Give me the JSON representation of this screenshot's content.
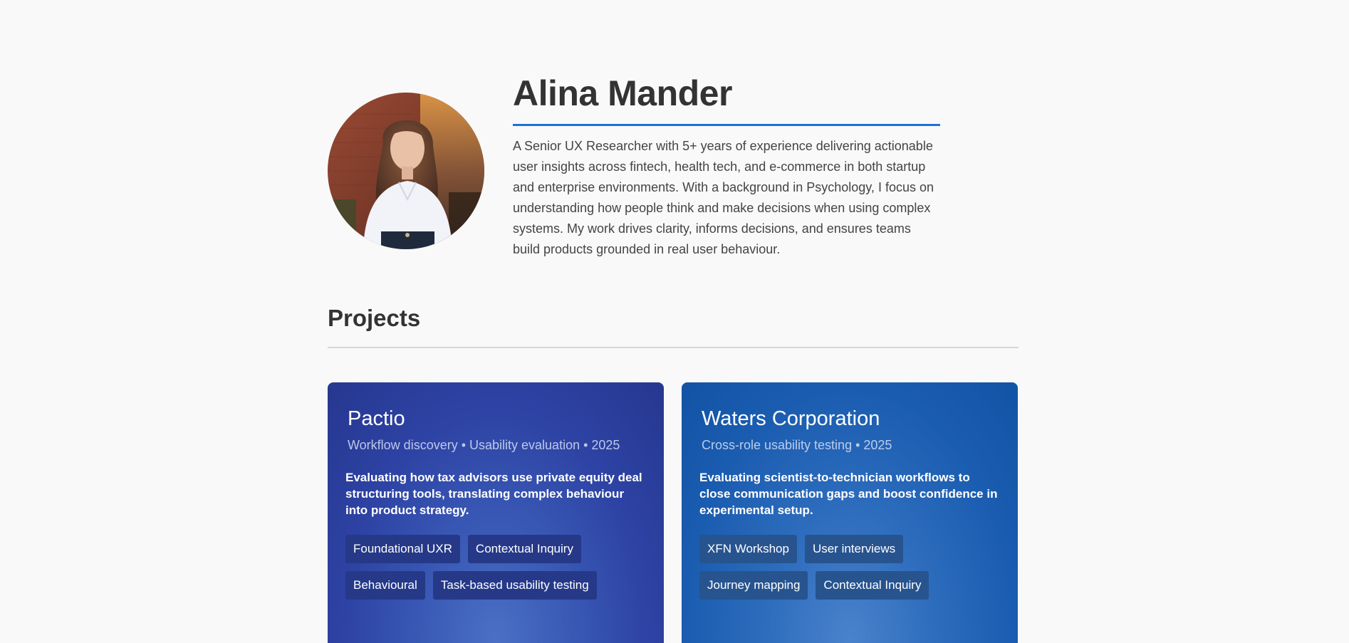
{
  "profile": {
    "name": "Alina Mander",
    "bio": "A Senior UX Researcher with 5+ years of experience delivering actionable user insights across fintech, health tech, and e-commerce in both startup and enterprise environments. With a background in Psychology, I focus on understanding how people think and make decisions when using complex systems. My work drives clarity, informs decisions, and ensures teams build products grounded in real user behaviour.",
    "accent_color": "#1a73d9"
  },
  "projects": {
    "heading": "Projects",
    "cards": [
      {
        "title": "Pactio",
        "meta": "Workflow discovery • Usability evaluation • 2025",
        "description": "Evaluating how tax advisors use private equity deal structuring tools, translating complex behaviour into product strategy.",
        "tags": [
          "Foundational UXR",
          "Contextual Inquiry",
          "Behavioural",
          "Task-based usability testing"
        ],
        "color": "#2d42a3"
      },
      {
        "title": "Waters Corporation",
        "meta": "Cross-role usability testing • 2025",
        "description": "Evaluating scientist-to-technician workflows to close communication gaps and boost confidence in experimental setup.",
        "tags": [
          "XFN Workshop",
          "User interviews",
          "Journey mapping",
          "Contextual Inquiry"
        ],
        "color": "#1a5cb0"
      }
    ]
  }
}
